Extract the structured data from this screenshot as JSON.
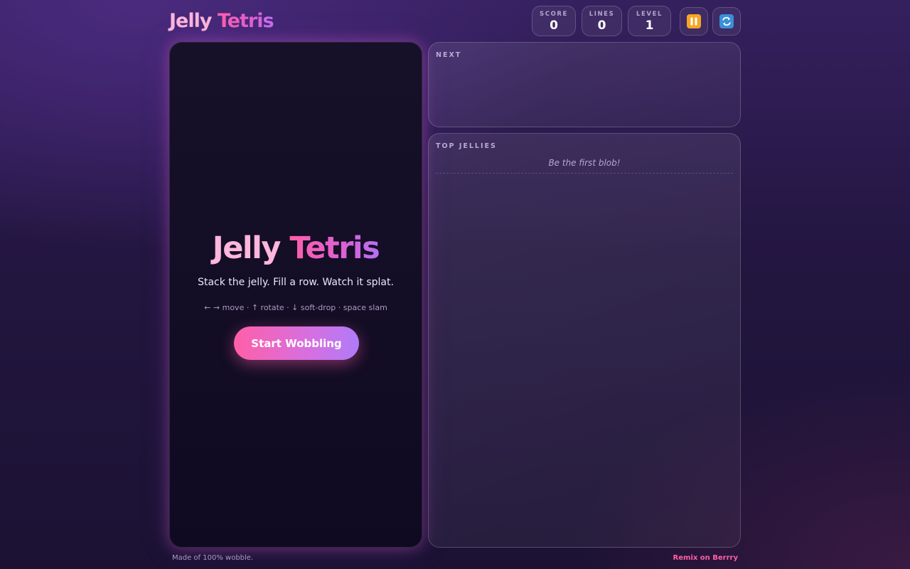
{
  "header": {
    "logo_word1": "Jelly",
    "logo_word2": "Tetris",
    "stats": {
      "score": {
        "label": "SCORE",
        "value": "0"
      },
      "lines": {
        "label": "LINES",
        "value": "0"
      },
      "level": {
        "label": "LEVEL",
        "value": "1"
      }
    },
    "buttons": {
      "pause_icon": "pause-icon",
      "restart_icon": "restart-icon"
    }
  },
  "board": {
    "overlay": {
      "title_word1": "Jelly",
      "title_word2": "Tetris",
      "tagline": "Stack the jelly. Fill a row. Watch it splat.",
      "controls": "← → move · ↑ rotate · ↓ soft-drop · space slam",
      "start_label": "Start Wobbling"
    }
  },
  "next_panel": {
    "title": "NEXT"
  },
  "scores_panel": {
    "title": "TOP JELLIES",
    "empty_text": "Be the first blob!"
  },
  "footer": {
    "left_text": "Made of 100% wobble.",
    "right_link": "Remix on Berrry"
  },
  "colors": {
    "accent_pink": "#ff5fa8",
    "accent_violet": "#b07bf8",
    "pause_orange": "#f5a623",
    "restart_blue": "#3b8ed8"
  }
}
